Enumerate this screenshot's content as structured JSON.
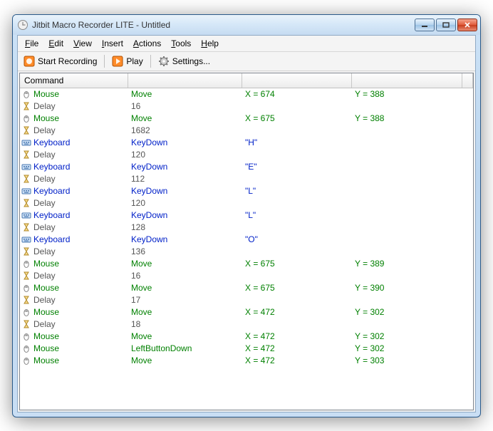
{
  "window": {
    "title": "Jitbit Macro Recorder LITE - Untitled"
  },
  "menu": {
    "file": "File",
    "edit": "Edit",
    "view": "View",
    "insert": "Insert",
    "actions": "Actions",
    "tools": "Tools",
    "help": "Help"
  },
  "toolbar": {
    "record": "Start Recording",
    "play": "Play",
    "settings": "Settings..."
  },
  "columns": {
    "c0": "Command",
    "c1": "",
    "c2": "",
    "c3": "",
    "c4": ""
  },
  "rows": [
    {
      "type": "mouse",
      "c0": "Mouse",
      "c1": "Move",
      "c2": "X = 674",
      "c3": "Y = 388"
    },
    {
      "type": "delay",
      "c0": "Delay",
      "c1": "16",
      "c2": "",
      "c3": ""
    },
    {
      "type": "mouse",
      "c0": "Mouse",
      "c1": "Move",
      "c2": "X = 675",
      "c3": "Y = 388"
    },
    {
      "type": "delay",
      "c0": "Delay",
      "c1": "1682",
      "c2": "",
      "c3": ""
    },
    {
      "type": "keyboard",
      "c0": "Keyboard",
      "c1": "KeyDown",
      "c2": "\"H\"",
      "c3": ""
    },
    {
      "type": "delay",
      "c0": "Delay",
      "c1": "120",
      "c2": "",
      "c3": ""
    },
    {
      "type": "keyboard",
      "c0": "Keyboard",
      "c1": "KeyDown",
      "c2": "\"E\"",
      "c3": ""
    },
    {
      "type": "delay",
      "c0": "Delay",
      "c1": "112",
      "c2": "",
      "c3": ""
    },
    {
      "type": "keyboard",
      "c0": "Keyboard",
      "c1": "KeyDown",
      "c2": "\"L\"",
      "c3": ""
    },
    {
      "type": "delay",
      "c0": "Delay",
      "c1": "120",
      "c2": "",
      "c3": ""
    },
    {
      "type": "keyboard",
      "c0": "Keyboard",
      "c1": "KeyDown",
      "c2": "\"L\"",
      "c3": ""
    },
    {
      "type": "delay",
      "c0": "Delay",
      "c1": "128",
      "c2": "",
      "c3": ""
    },
    {
      "type": "keyboard",
      "c0": "Keyboard",
      "c1": "KeyDown",
      "c2": "\"O\"",
      "c3": ""
    },
    {
      "type": "delay",
      "c0": "Delay",
      "c1": "136",
      "c2": "",
      "c3": ""
    },
    {
      "type": "mouse",
      "c0": "Mouse",
      "c1": "Move",
      "c2": "X = 675",
      "c3": "Y = 389"
    },
    {
      "type": "delay",
      "c0": "Delay",
      "c1": "16",
      "c2": "",
      "c3": ""
    },
    {
      "type": "mouse",
      "c0": "Mouse",
      "c1": "Move",
      "c2": "X = 675",
      "c3": "Y = 390"
    },
    {
      "type": "delay",
      "c0": "Delay",
      "c1": "17",
      "c2": "",
      "c3": ""
    },
    {
      "type": "mouse",
      "c0": "Mouse",
      "c1": "Move",
      "c2": "X = 472",
      "c3": "Y = 302"
    },
    {
      "type": "delay",
      "c0": "Delay",
      "c1": "18",
      "c2": "",
      "c3": ""
    },
    {
      "type": "mouse",
      "c0": "Mouse",
      "c1": "Move",
      "c2": "X = 472",
      "c3": "Y = 302"
    },
    {
      "type": "mouse",
      "c0": "Mouse",
      "c1": "LeftButtonDown",
      "c2": "X = 472",
      "c3": "Y = 302"
    },
    {
      "type": "mouse",
      "c0": "Mouse",
      "c1": "Move",
      "c2": "X = 472",
      "c3": "Y = 303"
    }
  ]
}
